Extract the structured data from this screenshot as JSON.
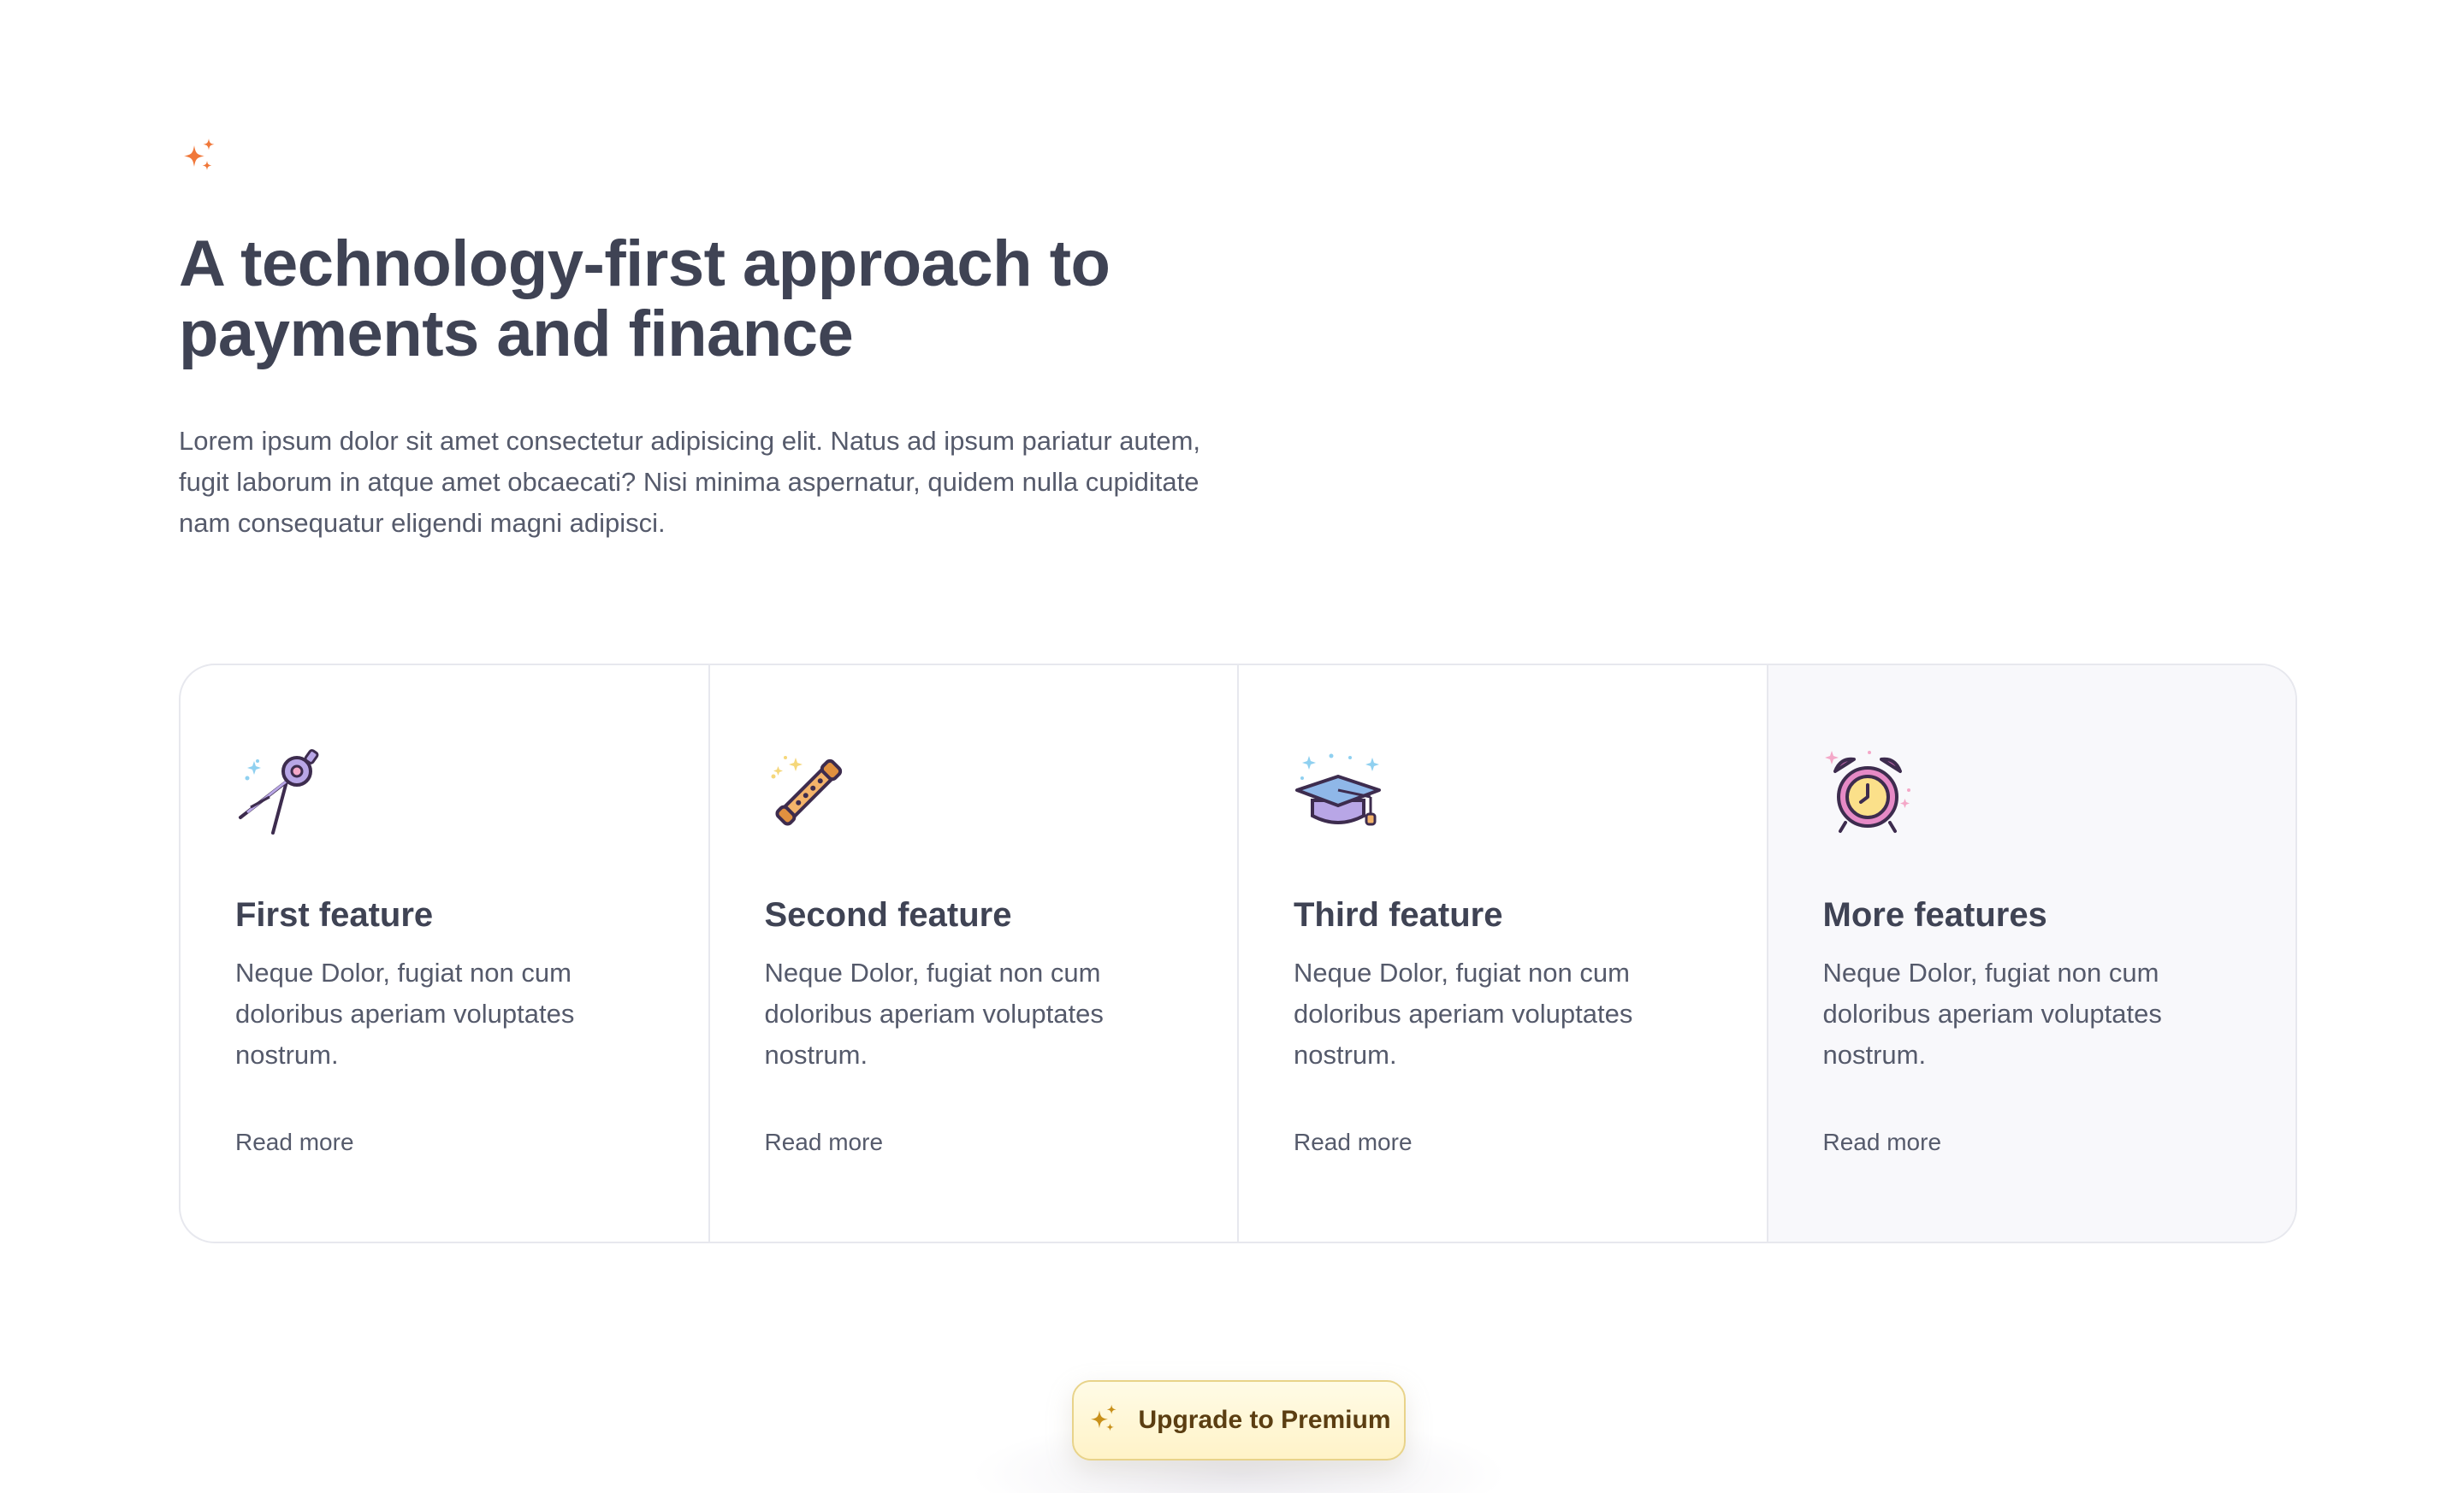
{
  "hero": {
    "logo_icon": "sparkles-icon",
    "title": "A technology-first approach to payments and finance",
    "description": "Lorem ipsum dolor sit amet consectetur adipisicing elit. Natus ad ipsum pariatur autem, fugit laborum in atque amet obcaecati? Nisi minima aspernatur, quidem nulla cupiditate nam consequatur eligendi magni adipisci."
  },
  "features": [
    {
      "icon": "compass-drafting-icon",
      "title": "First feature",
      "description": "Neque Dolor, fugiat non cum doloribus aperiam voluptates nostrum.",
      "link": "Read more"
    },
    {
      "icon": "flute-icon",
      "title": "Second feature",
      "description": "Neque Dolor, fugiat non cum doloribus aperiam voluptates nostrum.",
      "link": "Read more"
    },
    {
      "icon": "graduation-cap-icon",
      "title": "Third feature",
      "description": "Neque Dolor, fugiat non cum doloribus aperiam voluptates nostrum.",
      "link": "Read more"
    },
    {
      "icon": "alarm-clock-icon",
      "title": "More features",
      "description": "Neque Dolor, fugiat non cum doloribus aperiam voluptates nostrum.",
      "link": "Read more"
    }
  ],
  "upgrade": {
    "icon": "sparkles-icon",
    "label": "Upgrade to Premium"
  },
  "colors": {
    "accent_orange": "#f0783a",
    "text_dark": "#3f4354",
    "premium_bg": "#fff5d1",
    "premium_border": "#e8d38a"
  }
}
